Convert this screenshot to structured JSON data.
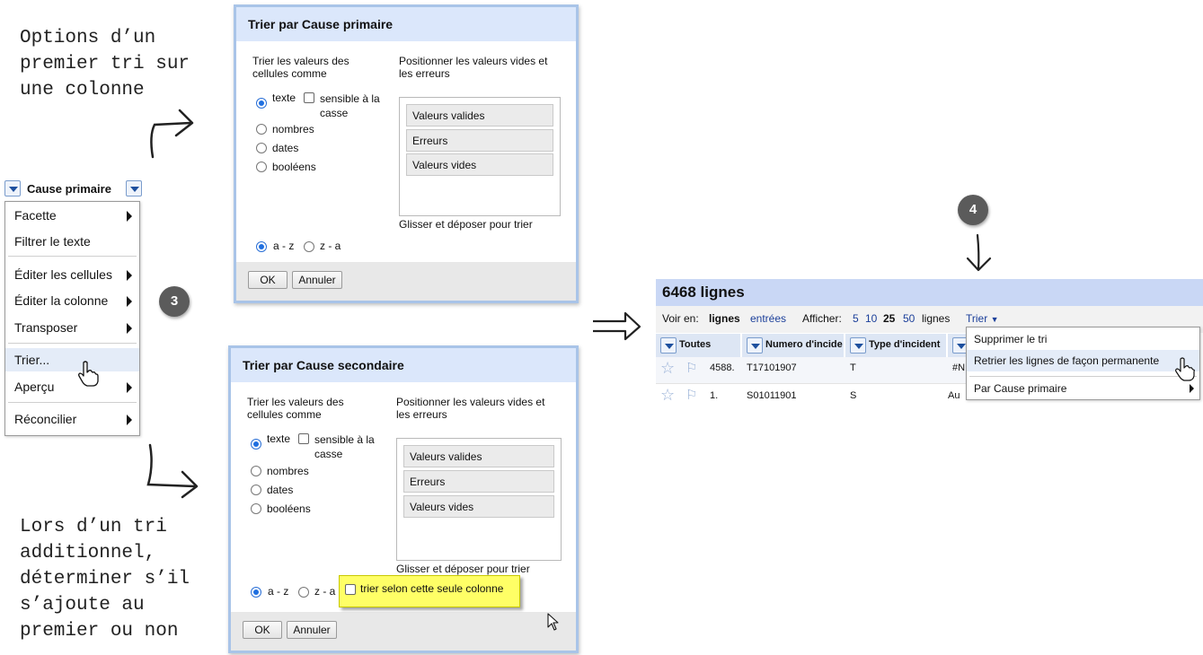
{
  "annotations": {
    "top_left": "Options d’un\npremier tri sur\nune colonne",
    "bottom_left": "Lors d’un tri\nadditionnel,\ndéterminer s’il\ns’ajoute au\npremier ou non",
    "badge_3": "3",
    "badge_4": "4"
  },
  "column_menu": {
    "header": "Cause primaire",
    "items": [
      {
        "label": "Facette",
        "submenu": true
      },
      {
        "label": "Filtrer le texte",
        "submenu": false
      },
      {
        "label": "Éditer les cellules",
        "submenu": true
      },
      {
        "label": "Éditer la colonne",
        "submenu": true
      },
      {
        "label": "Transposer",
        "submenu": true
      },
      {
        "label": "Trier...",
        "submenu": false
      },
      {
        "label": "Aperçu",
        "submenu": true
      },
      {
        "label": "Réconcilier",
        "submenu": true
      }
    ]
  },
  "dialog_primary": {
    "title": "Trier par Cause primaire",
    "sort_values_label": "Trier les valeurs des\ncellules comme",
    "position_label": "Positionner les valeurs vides et\nles erreurs",
    "types": [
      "texte",
      "nombres",
      "dates",
      "booléens"
    ],
    "case_sensitive": "sensible à la\ncasse",
    "positions": [
      "Valeurs valides",
      "Erreurs",
      "Valeurs vides"
    ],
    "drag_hint": "Glisser et déposer pour trier",
    "order_az": "a - z",
    "order_za": "z - a",
    "ok": "OK",
    "cancel": "Annuler"
  },
  "dialog_secondary": {
    "title": "Trier par Cause secondaire",
    "sort_values_label": "Trier les valeurs des\ncellules comme",
    "position_label": "Positionner les valeurs vides et\nles erreurs",
    "types": [
      "texte",
      "nombres",
      "dates",
      "booléens"
    ],
    "case_sensitive": "sensible à la\ncasse",
    "positions": [
      "Valeurs valides",
      "Erreurs",
      "Valeurs vides"
    ],
    "drag_hint": "Glisser et déposer pour trier",
    "order_az": "a - z",
    "order_za": "z - a",
    "only_this_column": "trier selon cette seule colonne",
    "ok": "OK",
    "cancel": "Annuler"
  },
  "grid_panel": {
    "row_count": "6468 lignes",
    "view_label": "Voir en:",
    "view_rows": "lignes",
    "view_records": "entrées",
    "show_label": "Afficher:",
    "page_sizes": [
      "5",
      "10",
      "25",
      "50"
    ],
    "page_size_selected": "25",
    "show_unit": "lignes",
    "sort_menu": "Trier",
    "columns": [
      "Toutes",
      "Numero d'incide",
      "Type d'incident"
    ],
    "rows": [
      {
        "index": "4588.",
        "numero": "T17101907",
        "type": "T",
        "extra": "#N"
      },
      {
        "index": "1.",
        "numero": "S01011901",
        "type": "S",
        "extra": "Au"
      }
    ],
    "sort_dropdown": [
      "Supprimer le tri",
      "Retrier les lignes de façon permanente",
      "Par Cause primaire"
    ]
  }
}
